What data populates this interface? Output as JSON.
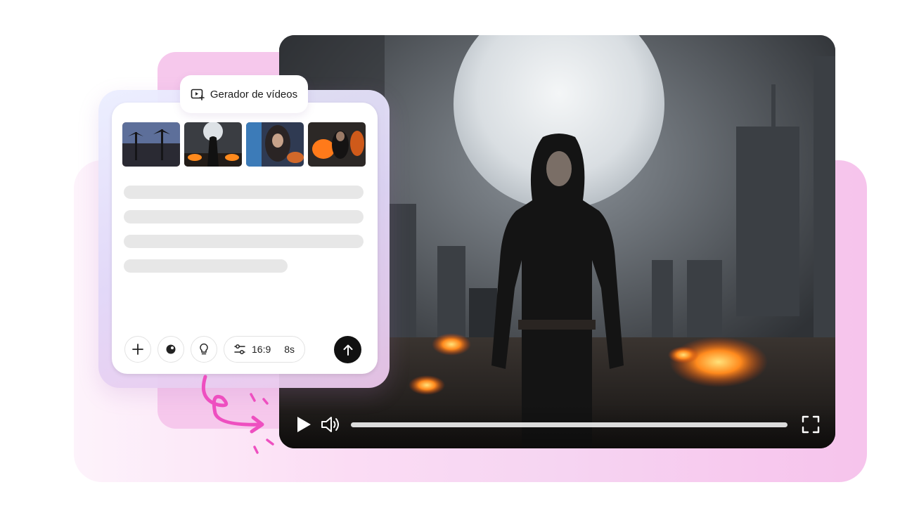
{
  "tag": {
    "label": "Gerador de vídeos",
    "icon": "video-add-icon"
  },
  "thumbnails": [
    {
      "name": "palm-sunset",
      "icon": "image-thumbnail"
    },
    {
      "name": "hooded-moon",
      "icon": "image-thumbnail"
    },
    {
      "name": "warrior-portrait",
      "icon": "image-thumbnail"
    },
    {
      "name": "fire-battle",
      "icon": "image-thumbnail"
    }
  ],
  "toolbar": {
    "add_icon": "plus-icon",
    "style_icon": "palette-icon",
    "idea_icon": "lightbulb-icon",
    "settings_icon": "sliders-icon",
    "aspect_ratio": "16:9",
    "duration": "8s",
    "send_icon": "arrow-up-icon"
  },
  "player": {
    "play_icon": "play-icon",
    "volume_icon": "volume-icon",
    "fullscreen_icon": "fullscreen-icon",
    "progress": 0
  },
  "colors": {
    "accent": "#ee4fc0",
    "send": "#111111",
    "blob": "#f6c8ec"
  }
}
